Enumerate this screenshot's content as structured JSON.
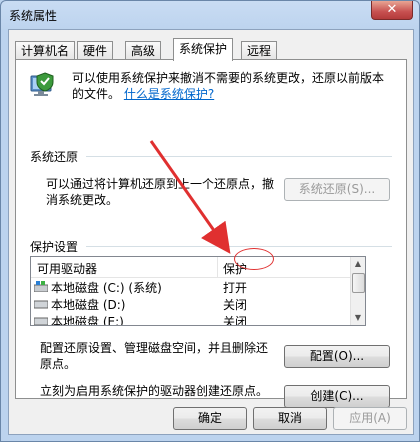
{
  "window": {
    "title": "系统属性",
    "close_label": "✕"
  },
  "tabs": [
    {
      "label": "计算机名",
      "active": false
    },
    {
      "label": "硬件",
      "active": false
    },
    {
      "label": "高级",
      "active": false
    },
    {
      "label": "系统保护",
      "active": true
    },
    {
      "label": "远程",
      "active": false
    }
  ],
  "intro": {
    "text": "可以使用系统保护来撤消不需要的系统更改，还原以前版本的文件。",
    "link": "什么是系统保护?"
  },
  "restore": {
    "group_title": "系统还原",
    "text": "可以通过将计算机还原到上一个还原点，撤消系统更改。",
    "button": "系统还原(S)..."
  },
  "protection": {
    "group_title": "保护设置",
    "col_drive": "可用驱动器",
    "col_protect": "保护",
    "rows": [
      {
        "drive": "本地磁盘 (C:) (系统)",
        "status": "打开",
        "icon": "system-drive-icon"
      },
      {
        "drive": "本地磁盘 (D:)",
        "status": "关闭",
        "icon": "drive-icon"
      },
      {
        "drive": "本地磁盘 (E:)",
        "status": "关闭",
        "icon": "drive-icon"
      }
    ],
    "config_text": "配置还原设置、管理磁盘空间，并且删除还原点。",
    "config_button": "配置(O)...",
    "create_text": "立刻为启用系统保护的驱动器创建还原点。",
    "create_button": "创建(C)..."
  },
  "footer": {
    "ok": "确定",
    "cancel": "取消",
    "apply": "应用(A)"
  },
  "colors": {
    "annotation": "#e03030",
    "link": "#0066cc"
  }
}
